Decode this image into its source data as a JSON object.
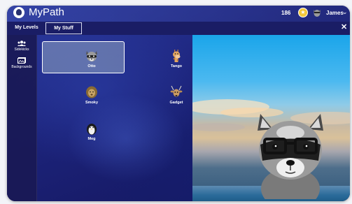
{
  "app": {
    "title": "MyPath"
  },
  "header": {
    "points": "186",
    "user_name": "James"
  },
  "tabs": [
    {
      "label": "My Levels"
    },
    {
      "label": "My Stuff"
    }
  ],
  "sidebar": {
    "items": [
      {
        "label": "Sidekicks",
        "icon": "people-icon"
      },
      {
        "label": "Backgrounds",
        "icon": "image-icon"
      }
    ]
  },
  "sidekicks": [
    {
      "name": "Otto",
      "icon": "raccoon-icon",
      "selected": true
    },
    {
      "name": "Tango",
      "icon": "giraffe-icon",
      "selected": false
    },
    {
      "name": "Smoky",
      "icon": "lion-icon",
      "selected": false
    },
    {
      "name": "Gadget",
      "icon": "deer-icon",
      "selected": false
    },
    {
      "name": "Meg",
      "icon": "penguin-icon",
      "selected": false
    }
  ],
  "colors": {
    "header_bg": "#1a1d65",
    "panel_bg": "#1c237a",
    "coin": "#f3c83b"
  }
}
